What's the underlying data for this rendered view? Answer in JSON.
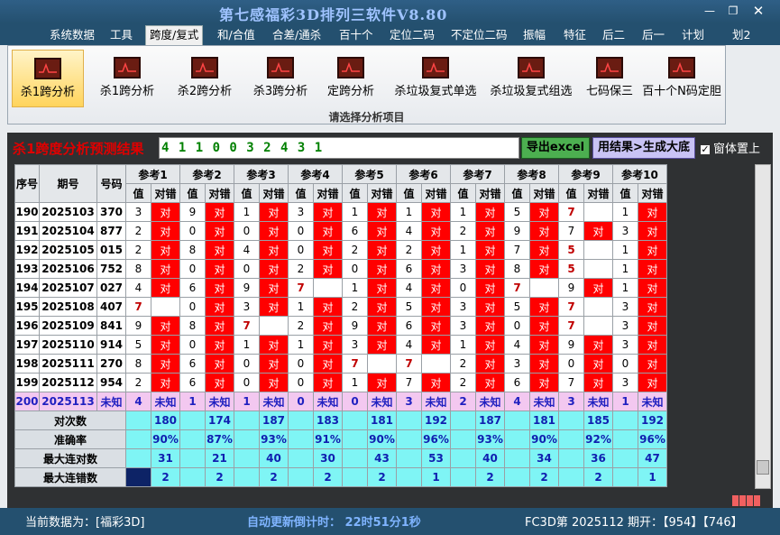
{
  "title": "第七感福彩3D排列三软件V8.80",
  "menu": [
    "系统数据",
    "工具",
    "跨度/复式",
    "和/合值",
    "合差/通杀",
    "百十个",
    "定位二码",
    "不定位二码",
    "振幅",
    "特征",
    "后二",
    "后一",
    "计划",
    "划2"
  ],
  "tools": [
    "杀1跨分析",
    "杀1跨分析",
    "杀2跨分析",
    "杀3跨分析",
    "定跨分析",
    "杀垃圾复式单选",
    "杀垃圾复式组选",
    "七码保三",
    "百十个N码定胆"
  ],
  "ribbon_caption": "请选择分析项目",
  "result_label": "杀1跨度分析预测结果",
  "result_value": "4 1 1 0 0 3 2 4 3 1",
  "export_label": "导出excel",
  "generate_label": "用结果>生成大底",
  "topmost_label": "窗体置上",
  "table": {
    "headers": {
      "seq": "序号",
      "period": "期号",
      "number": "号码",
      "refs": [
        "参考1",
        "参考2",
        "参考3",
        "参考4",
        "参考5",
        "参考6",
        "参考7",
        "参考8",
        "参考9",
        "参考10"
      ],
      "value": "值",
      "check": "对错"
    },
    "rows": [
      {
        "seq": "190",
        "period": "2025103",
        "number": "370",
        "cells": [
          [
            "3",
            "对"
          ],
          [
            "9",
            "对"
          ],
          [
            "1",
            "对"
          ],
          [
            "3",
            "对"
          ],
          [
            "1",
            "对"
          ],
          [
            "1",
            "对"
          ],
          [
            "1",
            "对"
          ],
          [
            "5",
            "对"
          ],
          [
            "7",
            ""
          ],
          [
            "1",
            "对"
          ]
        ]
      },
      {
        "seq": "191",
        "period": "2025104",
        "number": "877",
        "cells": [
          [
            "2",
            "对"
          ],
          [
            "0",
            "对"
          ],
          [
            "0",
            "对"
          ],
          [
            "0",
            "对"
          ],
          [
            "6",
            "对"
          ],
          [
            "4",
            "对"
          ],
          [
            "2",
            "对"
          ],
          [
            "9",
            "对"
          ],
          [
            "7",
            "对"
          ],
          [
            "3",
            "对"
          ]
        ]
      },
      {
        "seq": "192",
        "period": "2025105",
        "number": "015",
        "cells": [
          [
            "2",
            "对"
          ],
          [
            "8",
            "对"
          ],
          [
            "4",
            "对"
          ],
          [
            "0",
            "对"
          ],
          [
            "2",
            "对"
          ],
          [
            "2",
            "对"
          ],
          [
            "1",
            "对"
          ],
          [
            "7",
            "对"
          ],
          [
            "5",
            ""
          ],
          [
            "1",
            "对"
          ]
        ]
      },
      {
        "seq": "193",
        "period": "2025106",
        "number": "752",
        "cells": [
          [
            "8",
            "对"
          ],
          [
            "0",
            "对"
          ],
          [
            "0",
            "对"
          ],
          [
            "2",
            "对"
          ],
          [
            "0",
            "对"
          ],
          [
            "6",
            "对"
          ],
          [
            "3",
            "对"
          ],
          [
            "8",
            "对"
          ],
          [
            "5",
            ""
          ],
          [
            "1",
            "对"
          ]
        ]
      },
      {
        "seq": "194",
        "period": "2025107",
        "number": "027",
        "cells": [
          [
            "4",
            "对"
          ],
          [
            "6",
            "对"
          ],
          [
            "9",
            "对"
          ],
          [
            "7",
            ""
          ],
          [
            "1",
            "对"
          ],
          [
            "4",
            "对"
          ],
          [
            "0",
            "对"
          ],
          [
            "7",
            ""
          ],
          [
            "9",
            "对"
          ],
          [
            "1",
            "对"
          ]
        ]
      },
      {
        "seq": "195",
        "period": "2025108",
        "number": "407",
        "cells": [
          [
            "7",
            ""
          ],
          [
            "0",
            "对"
          ],
          [
            "3",
            "对"
          ],
          [
            "1",
            "对"
          ],
          [
            "2",
            "对"
          ],
          [
            "5",
            "对"
          ],
          [
            "3",
            "对"
          ],
          [
            "5",
            "对"
          ],
          [
            "7",
            ""
          ],
          [
            "3",
            "对"
          ]
        ]
      },
      {
        "seq": "196",
        "period": "2025109",
        "number": "841",
        "cells": [
          [
            "9",
            "对"
          ],
          [
            "8",
            "对"
          ],
          [
            "7",
            ""
          ],
          [
            "2",
            "对"
          ],
          [
            "9",
            "对"
          ],
          [
            "6",
            "对"
          ],
          [
            "3",
            "对"
          ],
          [
            "0",
            "对"
          ],
          [
            "7",
            ""
          ],
          [
            "3",
            "对"
          ]
        ]
      },
      {
        "seq": "197",
        "period": "2025110",
        "number": "914",
        "cells": [
          [
            "5",
            "对"
          ],
          [
            "0",
            "对"
          ],
          [
            "1",
            "对"
          ],
          [
            "1",
            "对"
          ],
          [
            "3",
            "对"
          ],
          [
            "4",
            "对"
          ],
          [
            "1",
            "对"
          ],
          [
            "4",
            "对"
          ],
          [
            "9",
            "对"
          ],
          [
            "3",
            "对"
          ]
        ]
      },
      {
        "seq": "198",
        "period": "2025111",
        "number": "270",
        "cells": [
          [
            "8",
            "对"
          ],
          [
            "6",
            "对"
          ],
          [
            "0",
            "对"
          ],
          [
            "0",
            "对"
          ],
          [
            "7",
            ""
          ],
          [
            "7",
            ""
          ],
          [
            "2",
            "对"
          ],
          [
            "3",
            "对"
          ],
          [
            "0",
            "对"
          ],
          [
            "0",
            "对"
          ]
        ]
      },
      {
        "seq": "199",
        "period": "2025112",
        "number": "954",
        "cells": [
          [
            "2",
            "对"
          ],
          [
            "6",
            "对"
          ],
          [
            "0",
            "对"
          ],
          [
            "0",
            "对"
          ],
          [
            "1",
            "对"
          ],
          [
            "7",
            "对"
          ],
          [
            "2",
            "对"
          ],
          [
            "6",
            "对"
          ],
          [
            "7",
            "对"
          ],
          [
            "3",
            "对"
          ]
        ]
      }
    ],
    "predict": {
      "seq": "200",
      "period": "2025113",
      "number": "未知",
      "cells": [
        [
          "4",
          "未知"
        ],
        [
          "1",
          "未知"
        ],
        [
          "1",
          "未知"
        ],
        [
          "0",
          "未知"
        ],
        [
          "0",
          "未知"
        ],
        [
          "3",
          "未知"
        ],
        [
          "2",
          "未知"
        ],
        [
          "4",
          "未知"
        ],
        [
          "3",
          "未知"
        ],
        [
          "1",
          "未知"
        ]
      ]
    },
    "stats": [
      {
        "label": "对次数",
        "values": [
          "180",
          "174",
          "187",
          "183",
          "181",
          "192",
          "187",
          "181",
          "185",
          "192"
        ]
      },
      {
        "label": "准确率",
        "values": [
          "90%",
          "87%",
          "93%",
          "91%",
          "90%",
          "96%",
          "93%",
          "90%",
          "92%",
          "96%"
        ]
      },
      {
        "label": "最大连对数",
        "values": [
          "31",
          "21",
          "40",
          "30",
          "43",
          "53",
          "40",
          "34",
          "36",
          "47"
        ]
      },
      {
        "label": "最大连错数",
        "values": [
          "2",
          "2",
          "2",
          "2",
          "2",
          "1",
          "2",
          "2",
          "2",
          "1"
        ]
      }
    ]
  },
  "status": {
    "current_data": "当前数据为：[福彩3D]",
    "countdown": "自动更新倒计时：  22时51分1秒",
    "draw": "FC3D第 2025112 期开：【954】【746】"
  },
  "colors": {
    "hit": "#ff0000",
    "predict_row": "#f3c8f0",
    "stats_row": "#7ff5f5",
    "title_bar": "#24506f"
  }
}
